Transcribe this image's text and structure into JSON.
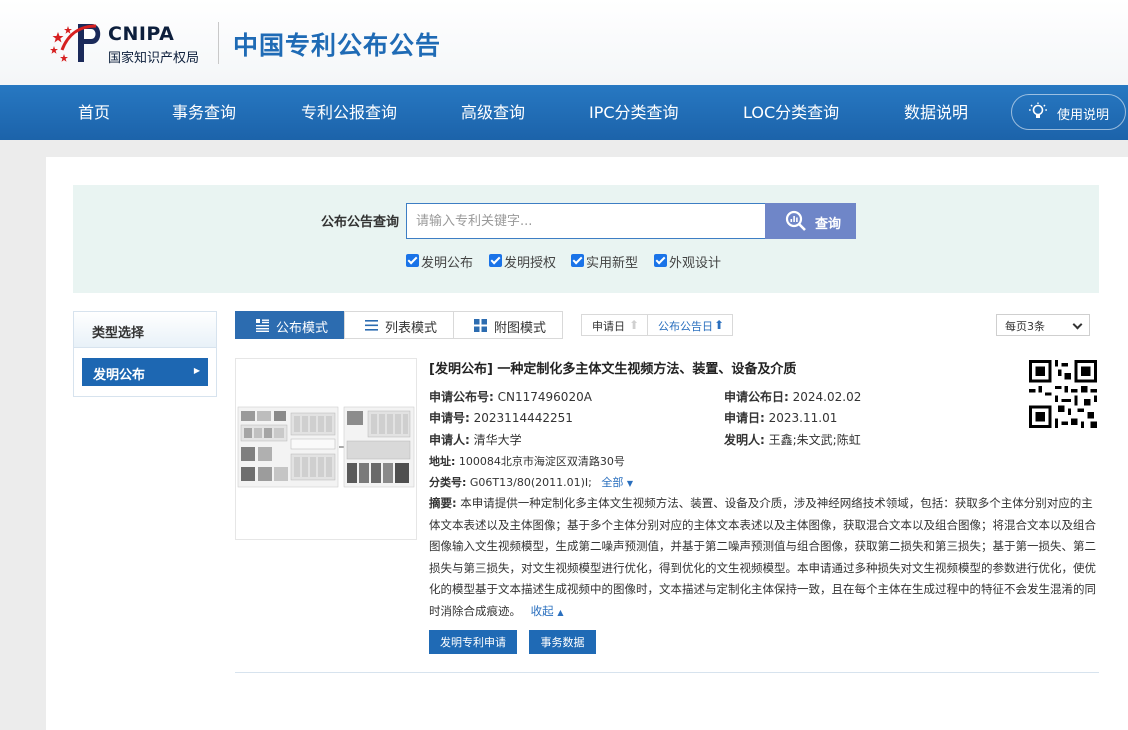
{
  "header": {
    "logo_en": "CNIPA",
    "logo_cn": "国家知识产权局",
    "site_title": "中国专利公布公告"
  },
  "nav": {
    "items": [
      "首页",
      "事务查询",
      "专利公报查询",
      "高级查询",
      "IPC分类查询",
      "LOC分类查询",
      "数据说明"
    ],
    "help_label": "使用说明"
  },
  "search": {
    "label": "公布公告查询",
    "placeholder": "请输入专利关键字...",
    "button": "查询",
    "types": [
      {
        "label": "发明公布",
        "checked": true
      },
      {
        "label": "发明授权",
        "checked": true
      },
      {
        "label": "实用新型",
        "checked": true
      },
      {
        "label": "外观设计",
        "checked": true
      }
    ]
  },
  "sidebar": {
    "heading": "类型选择",
    "items": [
      {
        "label": "发明公布"
      }
    ]
  },
  "toolbar": {
    "modes": [
      "公布模式",
      "列表模式",
      "附图模式"
    ],
    "sort": [
      "申请日",
      "公布公告日"
    ],
    "page_size": "每页3条"
  },
  "result": {
    "title": "[发明公布] 一种定制化多主体文生视频方法、装置、设备及介质",
    "pub_no_label": "申请公布号:",
    "pub_no": "CN117496020A",
    "pub_date_label": "申请公布日:",
    "pub_date": "2024.02.02",
    "app_no_label": "申请号:",
    "app_no": "2023114442251",
    "app_date_label": "申请日:",
    "app_date": "2023.11.01",
    "applicant_label": "申请人:",
    "applicant": "清华大学",
    "inventor_label": "发明人:",
    "inventor": "王鑫;朱文武;陈虹",
    "address_label": "地址:",
    "address": "100084北京市海淀区双清路30号",
    "class_label": "分类号:",
    "class": "G06T13/80(2011.01)I;",
    "class_all": "全部",
    "abstract_label": "摘要:",
    "abstract": "本申请提供一种定制化多主体文生视频方法、装置、设备及介质，涉及神经网络技术领域，包括：获取多个主体分别对应的主体文本表述以及主体图像；基于多个主体分别对应的主体文本表述以及主体图像，获取混合文本以及组合图像；将混合文本以及组合图像输入文生视频模型，生成第二噪声预测值，并基于第二噪声预测值与组合图像，获取第二损失和第三损失；基于第一损失、第二损失与第三损失，对文生视频模型进行优化，得到优化的文生视频模型。本申请通过多种损失对文生视频模型的参数进行优化，使优化的模型基于文本描述生成视频中的图像时，文本描述与定制化主体保持一致，且在每个主体在生成过程中的特征不会发生混淆的同时消除合成痕迹。",
    "collapse": "收起",
    "buttons": [
      "发明专利申请",
      "事务数据"
    ]
  },
  "colors": {
    "brand_blue": "#1f6bb5",
    "nav_blue": "#2270b9",
    "search_button": "#6f86c8",
    "panel_bg": "#e9f4f2"
  }
}
